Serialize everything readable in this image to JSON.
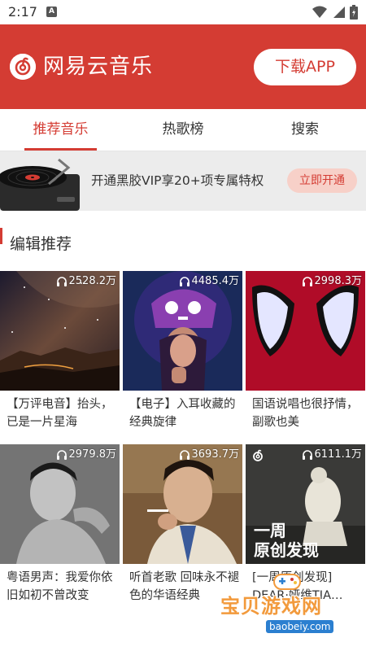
{
  "status": {
    "time": "2:17",
    "notif_icon": "A"
  },
  "header": {
    "app_title": "网易云音乐",
    "download_label": "下载APP",
    "brand_color": "#d43c33"
  },
  "tabs": [
    {
      "label": "推荐音乐",
      "active": true
    },
    {
      "label": "热歌榜",
      "active": false
    },
    {
      "label": "搜索",
      "active": false
    }
  ],
  "vip_banner": {
    "text": "开通黑胶VIP享20+项专属特权",
    "button_label": "立即开通"
  },
  "section": {
    "title": "编辑推荐"
  },
  "playlists": [
    {
      "play_count": "2528.2万",
      "title": "【万评电音】抬头，已是一片星海",
      "overlay": ""
    },
    {
      "play_count": "4485.4万",
      "title": "【电子】入耳收藏的经典旋律",
      "overlay": ""
    },
    {
      "play_count": "2998.3万",
      "title": "国语说唱也很抒情，副歌也美",
      "overlay": ""
    },
    {
      "play_count": "2979.8万",
      "title": "粤语男声：我爱你依旧如初不曾改变",
      "overlay": ""
    },
    {
      "play_count": "3693.7万",
      "title": "听首老歌 回味永不褪色的华语经典",
      "overlay": ""
    },
    {
      "play_count": "6111.1万",
      "title": "[一周原创发现] DEAR·娅维TIA…",
      "overlay_line1": "一周",
      "overlay_line2": "原创发现"
    }
  ],
  "watermark": {
    "text": "宝贝游戏网",
    "url": "baobeiy.com"
  }
}
